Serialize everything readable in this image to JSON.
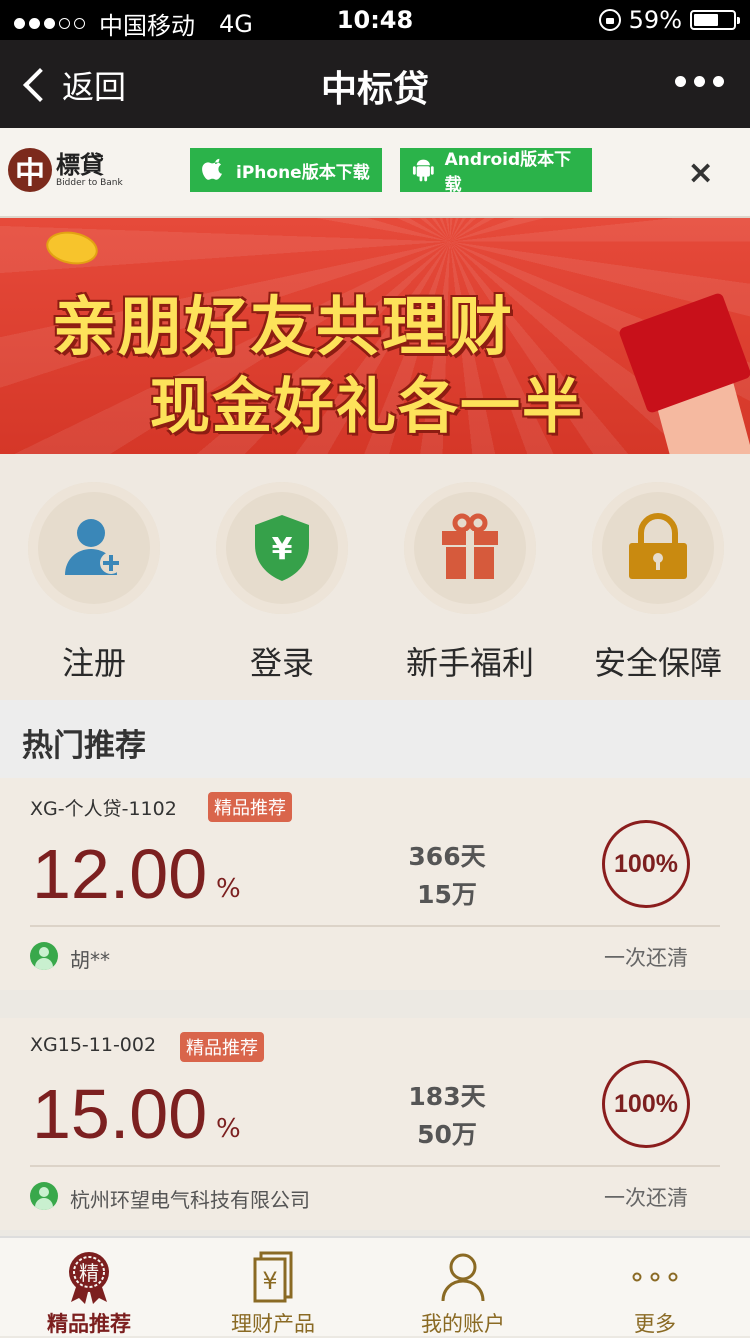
{
  "status_bar": {
    "carrier": "中国移动",
    "network": "4G",
    "time": "10:48",
    "battery": "59%"
  },
  "nav": {
    "back_label": "返回",
    "title": "中标贷"
  },
  "download_bar": {
    "logo_mark": "中",
    "logo_cn": "標貸",
    "logo_en": "Bidder to Bank",
    "iphone_label": "iPhone版本下载",
    "android_label": "Android版本下载",
    "close": "×"
  },
  "banner": {
    "line1": "亲朋好友共理财",
    "line2": "现金好礼各一半"
  },
  "shortcuts": [
    {
      "label": "注册",
      "icon": "user-plus-icon"
    },
    {
      "label": "登录",
      "icon": "shield-yuan-icon"
    },
    {
      "label": "新手福利",
      "icon": "gift-icon"
    },
    {
      "label": "安全保障",
      "icon": "padlock-icon"
    }
  ],
  "section": {
    "title": "热门推荐"
  },
  "products": [
    {
      "name": "XG-个人贷-1102",
      "tag": "精品推荐",
      "rate": "12.00",
      "rate_unit": "%",
      "term": "366天",
      "amount": "15万",
      "progress": "100%",
      "borrower": "胡**",
      "repayment": "一次还清"
    },
    {
      "name": "XG15-11-002",
      "tag": "精品推荐",
      "rate": "15.00",
      "rate_unit": "%",
      "term": "183天",
      "amount": "50万",
      "progress": "100%",
      "borrower": "杭州环望电气科技有限公司",
      "repayment": "一次还清"
    }
  ],
  "tabs": [
    {
      "label": "精品推荐",
      "icon": "badge-jing-icon",
      "active": true
    },
    {
      "label": "理财产品",
      "icon": "yuan-document-icon",
      "active": false
    },
    {
      "label": "我的账户",
      "icon": "user-icon",
      "active": false
    },
    {
      "label": "更多",
      "icon": "more-dots-icon",
      "active": false
    }
  ]
}
